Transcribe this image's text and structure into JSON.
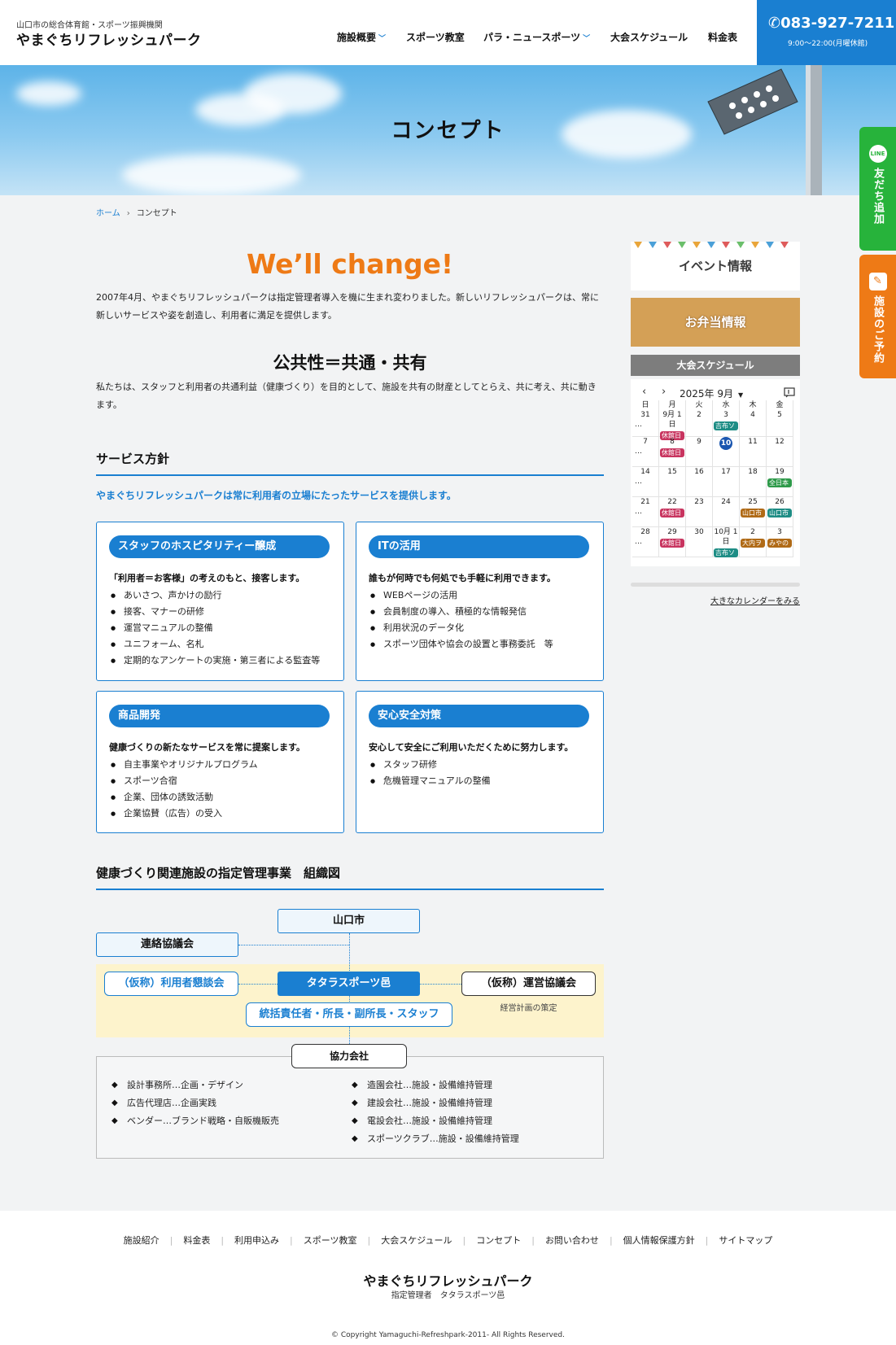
{
  "header": {
    "logo_sub": "山口市の総合体育館・スポーツ振興機関",
    "logo_main": "やまぐちリフレッシュパーク",
    "nav": [
      {
        "label": "施設概要",
        "has_dropdown": true
      },
      {
        "label": "スポーツ教室",
        "has_dropdown": false
      },
      {
        "label": "パラ・ニュースポーツ",
        "has_dropdown": true
      },
      {
        "label": "大会スケジュール",
        "has_dropdown": false
      },
      {
        "label": "料金表",
        "has_dropdown": false
      }
    ],
    "phone": "083-927-7211",
    "hours": "9:00〜22:00(月曜休館)"
  },
  "hero": {
    "title": "コンセプト"
  },
  "side_tabs": {
    "line_icon": "LINE",
    "line_label": "友だち追加",
    "booking_icon": "pencil-icon",
    "booking_label": "施設のご予約"
  },
  "breadcrumb": {
    "home": "ホーム",
    "current": "コンセプト"
  },
  "main": {
    "headline": "We’ll change!",
    "intro": "2007年4月、やまぐちリフレッシュパークは指定管理者導入を機に生まれ変わりました。新しいリフレッシュパークは、常に新しいサービスや姿を創造し、利用者に満足を提供します。",
    "public_title": "公共性＝共通・共有",
    "public_text": "私たちは、スタッフと利用者の共通利益（健康づくり）を目的として、施設を共有の財産としてとらえ、共に考え、共に動きます。",
    "service_title": "サービス方針",
    "service_lead": "やまぐちリフレッシュパークは常に利用者の立場にたったサービスを提供します。",
    "cards": [
      {
        "title": "スタッフのホスピタリティー醸成",
        "lead": "「利用者＝お客様」の考えのもと、接客します。",
        "items": [
          "あいさつ、声かけの励行",
          "接客、マナーの研修",
          "運営マニュアルの整備",
          "ユニフォーム、名札",
          "定期的なアンケートの実施・第三者による監査等"
        ]
      },
      {
        "title": "ITの活用",
        "lead": "誰もが何時でも何処でも手軽に利用できます。",
        "items": [
          "WEBページの活用",
          "会員制度の導入、積極的な情報発信",
          "利用状況のデータ化",
          "スポーツ団体や協会の設置と事務委託　等"
        ]
      },
      {
        "title": "商品開発",
        "lead": "健康づくりの新たなサービスを常に提案します。",
        "items": [
          "自主事業やオリジナルプログラム",
          "スポーツ合宿",
          "企業、団体の誘致活動",
          "企業協賛（広告）の受入"
        ]
      },
      {
        "title": "安心安全対策",
        "lead": "安心して安全にご利用いただくために努力します。",
        "items": [
          "スタッフ研修",
          "危機管理マニュアルの整備"
        ]
      }
    ],
    "org_title": "健康づくり関連施設の指定管理事業　組織図",
    "org": {
      "city": "山口市",
      "liaison": "連絡協議会",
      "users": "（仮称）利用者懇談会",
      "operator": "タタラスポーツ邑",
      "ops_council": "（仮称）運営協議会",
      "ops_note": "経営計画の策定",
      "staff": "統括責任者・所長・副所長・スタッフ",
      "partner": "協力会社",
      "partners_left": [
        "設計事務所…企画・デザイン",
        "広告代理店…企画実践",
        "ベンダー…ブランド戦略・自販機販売"
      ],
      "partners_right": [
        "造園会社…施設・設備維持管理",
        "建設会社…施設・設備維持管理",
        "電設会社…施設・設備維持管理",
        "スポーツクラブ…施設・設備維持管理"
      ]
    }
  },
  "sidebar": {
    "event_banner": "イベント情報",
    "bento_banner": "お弁当情報",
    "schedule_head": "大会スケジュール",
    "calendar": {
      "prev": "‹",
      "next": "›",
      "month": "2025年 9月",
      "weekdays": [
        "日",
        "月",
        "火",
        "水",
        "木",
        "金"
      ],
      "rows": [
        [
          {
            "d": "31",
            "more": "…"
          },
          {
            "d": "9月 1日",
            "ev": "休館日",
            "c": "red"
          },
          {
            "d": "2"
          },
          {
            "d": "3",
            "ev": "吉布ソ",
            "c": "teal"
          },
          {
            "d": "4"
          },
          {
            "d": "5"
          }
        ],
        [
          {
            "d": "7",
            "more": "…"
          },
          {
            "d": "8",
            "ev": "休館日",
            "c": "red"
          },
          {
            "d": "9"
          },
          {
            "d": "10",
            "today": true
          },
          {
            "d": "11"
          },
          {
            "d": "12"
          }
        ],
        [
          {
            "d": "14",
            "more": "…"
          },
          {
            "d": "15"
          },
          {
            "d": "16"
          },
          {
            "d": "17"
          },
          {
            "d": "18"
          },
          {
            "d": "19",
            "ev": "全日本",
            "c": "green"
          }
        ],
        [
          {
            "d": "21",
            "more": "…"
          },
          {
            "d": "22",
            "ev": "休館日",
            "c": "red"
          },
          {
            "d": "23"
          },
          {
            "d": "24"
          },
          {
            "d": "25",
            "ev": "山口市",
            "c": "brown"
          },
          {
            "d": "26",
            "ev": "山口市",
            "c": "teal"
          }
        ],
        [
          {
            "d": "28",
            "more": "…"
          },
          {
            "d": "29",
            "ev": "休館日",
            "c": "red"
          },
          {
            "d": "30"
          },
          {
            "d": "10月 1日",
            "ev": "吉布ソ",
            "c": "teal"
          },
          {
            "d": "2",
            "ev": "大内ヲ",
            "c": "brown"
          },
          {
            "d": "3",
            "ev": "みやの",
            "c": "brown"
          }
        ]
      ]
    },
    "calendar_more": "大きなカレンダーをみる"
  },
  "footer": {
    "nav": [
      "施設紹介",
      "料金表",
      "利用申込み",
      "スポーツ教室",
      "大会スケジュール",
      "コンセプト",
      "お問い合わせ",
      "個人情報保護方針",
      "サイトマップ"
    ],
    "title": "やまぐちリフレッシュパーク",
    "sub": "指定管理者　タタラスポーツ邑",
    "copyright": "© Copyright Yamaguchi-Refreshpark-2011- All Rights Reserved."
  },
  "colors": {
    "accent_blue": "#1a7fd1",
    "accent_orange": "#ee7a16",
    "line_green": "#27b33b"
  }
}
